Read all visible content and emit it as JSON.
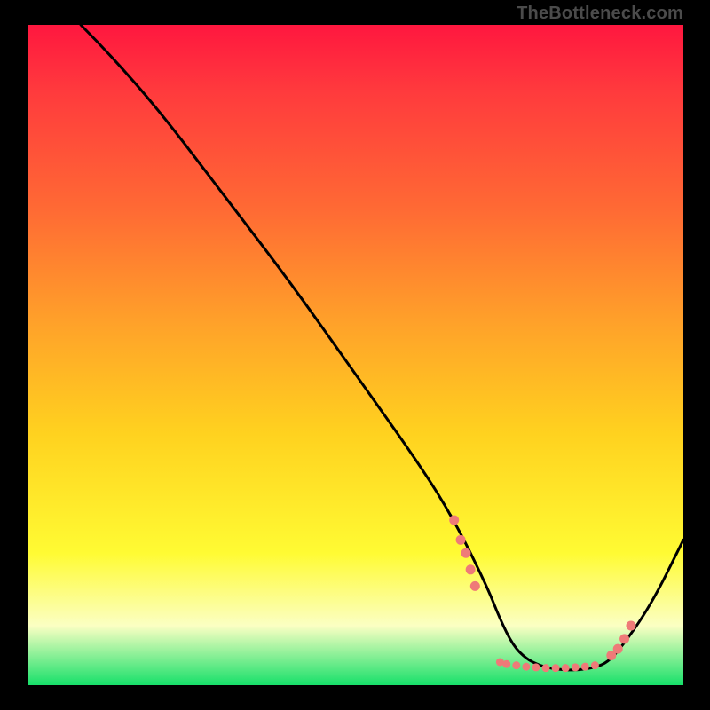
{
  "attribution": "TheBottleneck.com",
  "gradient_colors": {
    "top": "#ff173f",
    "upper_mid": "#ff6a34",
    "mid": "#ffd21f",
    "lower_mid": "#fbffc3",
    "bottom": "#17e06a"
  },
  "curve_color": "#000000",
  "marker_color": "#ef7a78",
  "chart_data": {
    "type": "line",
    "title": "",
    "xlabel": "",
    "ylabel": "",
    "xlim": [
      0,
      100
    ],
    "ylim": [
      0,
      100
    ],
    "grid": false,
    "series": [
      {
        "name": "bottleneck-curve",
        "x": [
          8,
          12,
          20,
          30,
          40,
          50,
          60,
          65,
          70,
          72,
          74,
          76,
          78,
          80,
          82,
          84,
          86,
          88,
          90,
          95,
          100
        ],
        "y": [
          100,
          96,
          87,
          74,
          61,
          47,
          33,
          25,
          15,
          10,
          6,
          4,
          3,
          2.5,
          2.3,
          2.3,
          2.6,
          3.2,
          5,
          12,
          22
        ]
      }
    ],
    "markers": {
      "left_cluster_x": [
        65,
        66,
        66.8,
        67.5,
        68.2
      ],
      "left_cluster_y": [
        25,
        22,
        20,
        17.5,
        15
      ],
      "flat_cluster_x": [
        72,
        73,
        74.5,
        76,
        77.5,
        79,
        80.5,
        82,
        83.5,
        85,
        86.5
      ],
      "flat_cluster_y": [
        3.5,
        3.2,
        3.0,
        2.8,
        2.7,
        2.6,
        2.6,
        2.6,
        2.7,
        2.8,
        3.0
      ],
      "right_cluster_x": [
        89,
        90,
        91,
        92
      ],
      "right_cluster_y": [
        4.5,
        5.5,
        7,
        9
      ]
    }
  }
}
